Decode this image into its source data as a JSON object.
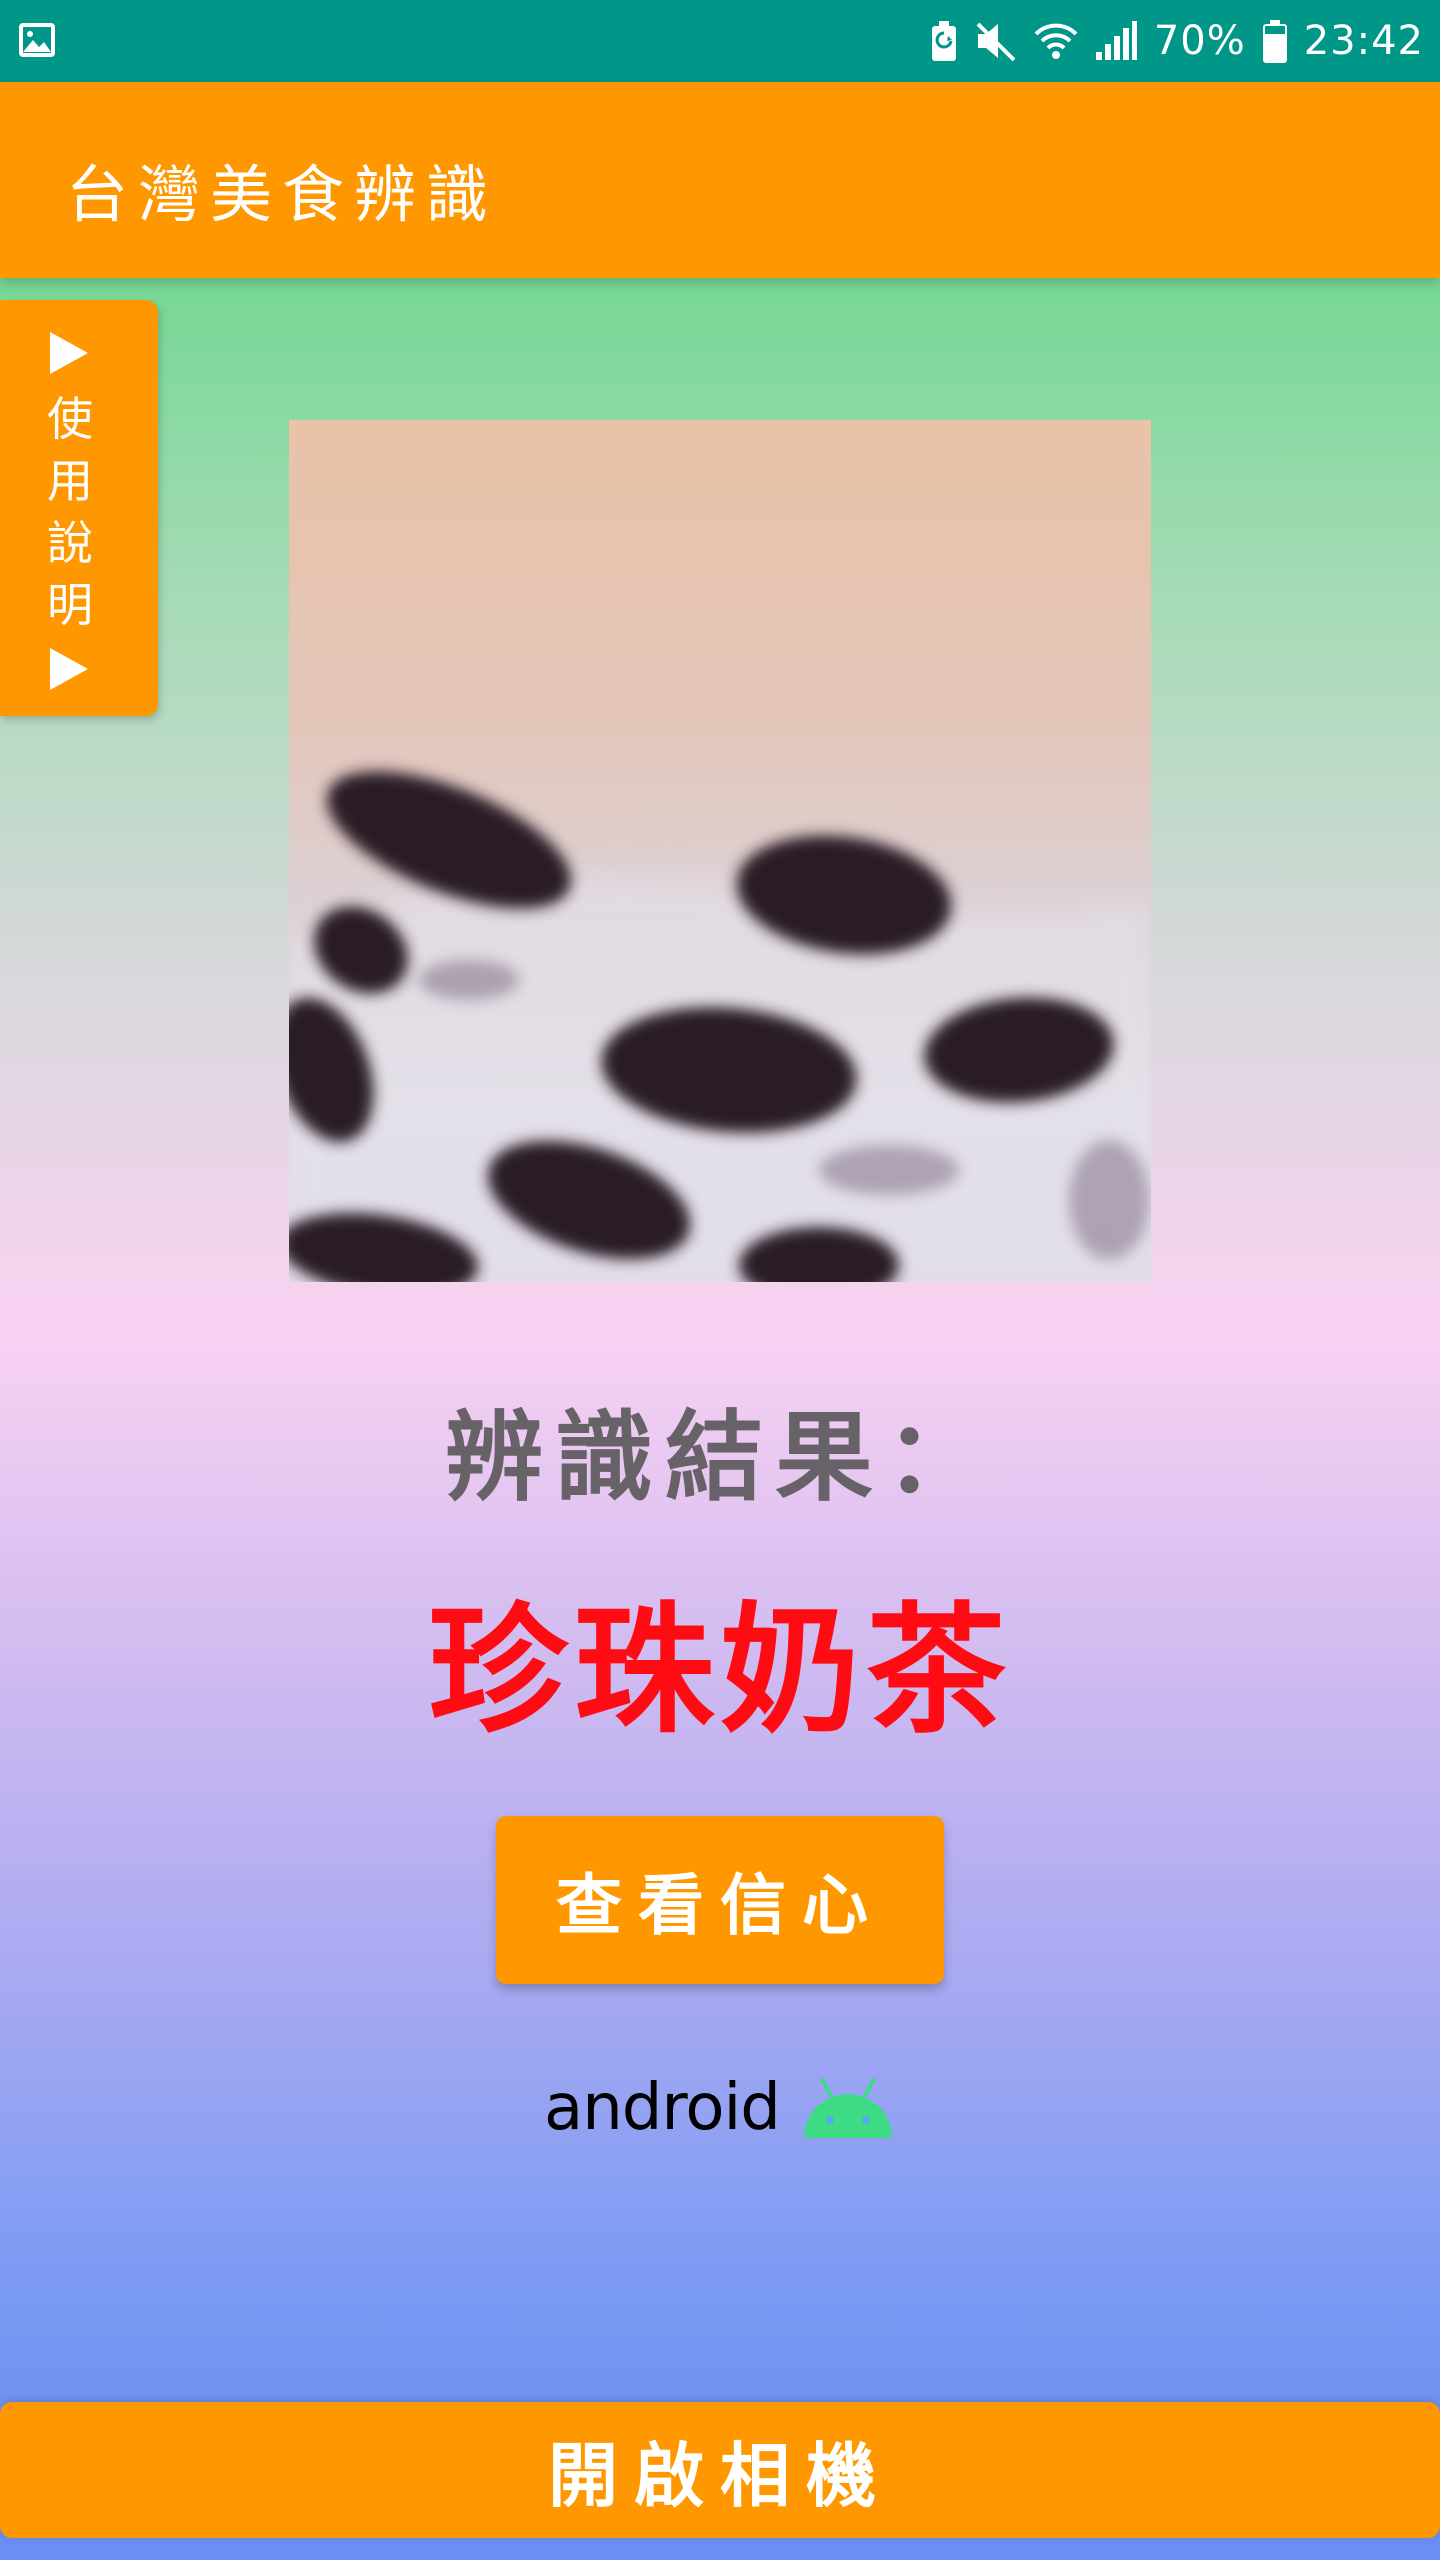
{
  "status_bar": {
    "icons": [
      "image-icon",
      "battery-saver-icon",
      "mute-icon",
      "wifi-icon",
      "signal-icon",
      "battery-icon"
    ],
    "battery": "70%",
    "time": "23:42",
    "background": "#009688"
  },
  "app_bar": {
    "title": "台灣美食辨識",
    "background": "#ff9800"
  },
  "side_panel": {
    "label": "使用說明",
    "arrow_glyph": "▶"
  },
  "photo": {
    "icon": "bubble-tea-photo"
  },
  "result": {
    "heading": "辨識結果：",
    "value": "珍珠奶茶",
    "value_color": "#ff0b14"
  },
  "buttons": {
    "confidence": "查看信心",
    "open_camera": "開啟相機"
  },
  "branding": {
    "text": "android",
    "robot_color": "#3ddc84"
  },
  "accent_color": "#ff9800"
}
